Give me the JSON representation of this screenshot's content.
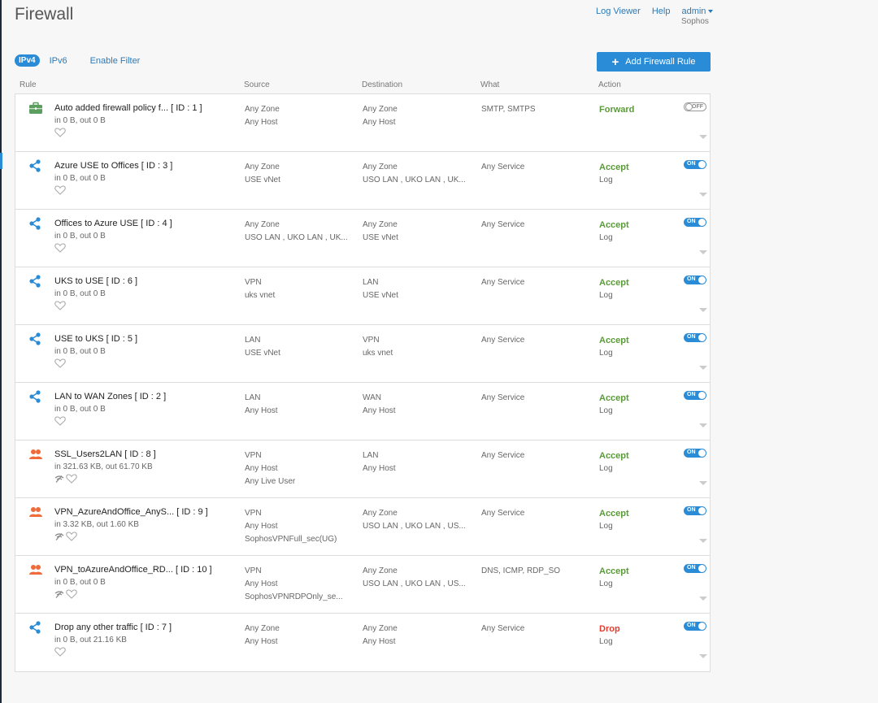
{
  "header": {
    "title": "Firewall",
    "links": [
      "Log Viewer",
      "Help"
    ],
    "user": "admin",
    "org": "Sophos"
  },
  "filters": {
    "ipv4": "IPv4",
    "ipv6": "IPv6",
    "enable_filter": "Enable Filter"
  },
  "add_button": "Add Firewall Rule",
  "columns": {
    "rule": "Rule",
    "source": "Source",
    "destination": "Destination",
    "what": "What",
    "action": "Action"
  },
  "colors": {
    "accent": "#2a8bd6",
    "accept": "#5b9a3a",
    "drop": "#e03c2f",
    "user_icon": "#ef6b3a",
    "policy_icon": "#5c9e5e"
  },
  "toggle_labels": {
    "on": "ON",
    "off": "OFF"
  },
  "rules": [
    {
      "icon": "briefcase-icon",
      "name": "Auto added firewall policy f...   [ ID : 1 ]",
      "traffic": "in 0 B, out 0 B",
      "signal": false,
      "source": [
        "Any Zone",
        "Any Host"
      ],
      "destination": [
        "Any Zone",
        "Any Host"
      ],
      "what": "SMTP, SMTPS",
      "action": "Forward",
      "action_type": "forward",
      "log": "",
      "enabled": false
    },
    {
      "icon": "share-icon",
      "name": "Azure USE to Offices  [ ID : 3 ]",
      "traffic": "in 0 B, out 0 B",
      "signal": false,
      "source": [
        "Any Zone",
        "USE vNet"
      ],
      "destination": [
        "Any Zone",
        "USO LAN , UKO LAN , UK..."
      ],
      "what": "Any Service",
      "action": "Accept",
      "action_type": "accept",
      "log": "Log",
      "enabled": true
    },
    {
      "icon": "share-icon",
      "name": "Offices to Azure USE  [ ID : 4 ]",
      "traffic": "in 0 B, out 0 B",
      "signal": false,
      "source": [
        "Any Zone",
        "USO LAN , UKO LAN , UK..."
      ],
      "destination": [
        "Any Zone",
        "USE vNet"
      ],
      "what": "Any Service",
      "action": "Accept",
      "action_type": "accept",
      "log": "Log",
      "enabled": true
    },
    {
      "icon": "share-icon",
      "name": "UKS to USE  [ ID : 6 ]",
      "traffic": "in 0 B, out 0 B",
      "signal": false,
      "source": [
        "VPN",
        "uks vnet"
      ],
      "destination": [
        "LAN",
        "USE vNet"
      ],
      "what": "Any Service",
      "action": "Accept",
      "action_type": "accept",
      "log": "Log",
      "enabled": true
    },
    {
      "icon": "share-icon",
      "name": "USE to UKS  [ ID : 5 ]",
      "traffic": "in 0 B, out 0 B",
      "signal": false,
      "source": [
        "LAN",
        "USE vNet"
      ],
      "destination": [
        "VPN",
        "uks vnet"
      ],
      "what": "Any Service",
      "action": "Accept",
      "action_type": "accept",
      "log": "Log",
      "enabled": true
    },
    {
      "icon": "share-icon",
      "name": "LAN to WAN Zones  [ ID : 2 ]",
      "traffic": "in 0 B, out 0 B",
      "signal": false,
      "source": [
        "LAN",
        "Any Host"
      ],
      "destination": [
        "WAN",
        "Any Host"
      ],
      "what": "Any Service",
      "action": "Accept",
      "action_type": "accept",
      "log": "Log",
      "enabled": true
    },
    {
      "icon": "users-icon",
      "name": "SSL_Users2LAN  [ ID : 8 ]",
      "traffic": "in 321.63 KB, out 61.70 KB",
      "signal": true,
      "source": [
        "VPN",
        "Any Host",
        "Any Live User"
      ],
      "destination": [
        "LAN",
        "Any Host"
      ],
      "what": "Any Service",
      "action": "Accept",
      "action_type": "accept",
      "log": "Log",
      "enabled": true
    },
    {
      "icon": "users-icon",
      "name": "VPN_AzureAndOffice_AnyS...  [ ID : 9 ]",
      "traffic": "in 3.32 KB, out 1.60 KB",
      "signal": true,
      "source": [
        "VPN",
        "Any Host",
        "SophosVPNFull_sec(UG)"
      ],
      "destination": [
        "Any Zone",
        "USO LAN , UKO LAN , US..."
      ],
      "what": "Any Service",
      "action": "Accept",
      "action_type": "accept",
      "log": "Log",
      "enabled": true
    },
    {
      "icon": "users-icon",
      "name": "VPN_toAzureAndOffice_RD...  [ ID : 10 ]",
      "traffic": "in 0 B, out 0 B",
      "signal": true,
      "source": [
        "VPN",
        "Any Host",
        "SophosVPNRDPOnly_se..."
      ],
      "destination": [
        "Any Zone",
        "USO LAN , UKO LAN , US..."
      ],
      "what": "DNS, ICMP, RDP_SO",
      "action": "Accept",
      "action_type": "accept",
      "log": "Log",
      "enabled": true
    },
    {
      "icon": "share-icon",
      "name": "Drop any other traffic  [ ID : 7 ]",
      "traffic": "in 0 B, out 21.16 KB",
      "signal": false,
      "source": [
        "Any Zone",
        "Any Host"
      ],
      "destination": [
        "Any Zone",
        "Any Host"
      ],
      "what": "Any Service",
      "action": "Drop",
      "action_type": "drop",
      "log": "Log",
      "enabled": true
    }
  ]
}
